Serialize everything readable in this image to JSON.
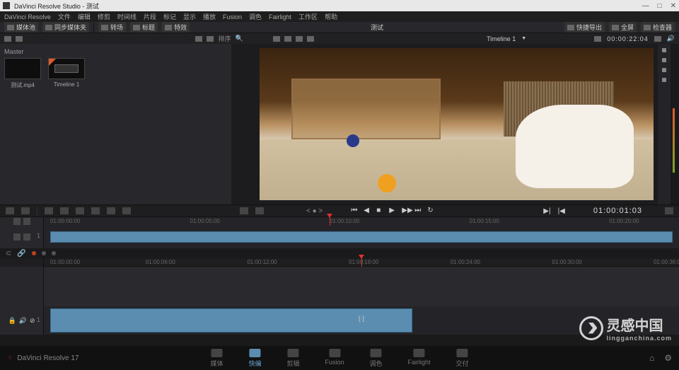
{
  "window": {
    "title": "DaVinci Resolve Studio - 测试",
    "min": "—",
    "max": "□",
    "close": "✕"
  },
  "menu": [
    "DaVinci Resolve",
    "文件",
    "编辑",
    "修剪",
    "时间线",
    "片段",
    "标记",
    "显示",
    "播放",
    "Fusion",
    "调色",
    "Fairlight",
    "工作区",
    "帮助"
  ],
  "toolbar": {
    "mediapool": "媒体池",
    "sync": "同步媒体夹",
    "transitions": "转场",
    "titles": "标题",
    "effects": "特效",
    "center": "测试",
    "quickexport": "快捷导出",
    "fullscreen": "全屏",
    "inspector": "检查器"
  },
  "subbar": {
    "timeline_name": "Timeline 1",
    "timecode": "00:00:22:04"
  },
  "pool": {
    "root": "Master",
    "clips": [
      {
        "name": "测试.mp4"
      },
      {
        "name": "Timeline 1"
      }
    ]
  },
  "transport": {
    "first": "⏮",
    "prev": "◀",
    "stop": "■",
    "play": "▶",
    "next": "▶▶",
    "last": "⏭",
    "loop": "↻",
    "skip_prev": "▶|",
    "skip_next": "|◀",
    "tc": "01:00:01:03"
  },
  "ruler_upper": [
    "01:00:00:00",
    "01:00:05:00",
    "01:00:10:00",
    "01:00:15:00",
    "01:00:20:00"
  ],
  "ruler_lower": [
    "01:00:00:00",
    "01:00:06:00",
    "01:00:12:00",
    "01:00:18:00",
    "01:00:24:00",
    "01:00:30:00",
    "01:00:36:00"
  ],
  "pages": [
    {
      "key": "media",
      "label": "媒体"
    },
    {
      "key": "cut",
      "label": "快编"
    },
    {
      "key": "edit",
      "label": "剪辑"
    },
    {
      "key": "fusion",
      "label": "Fusion"
    },
    {
      "key": "color",
      "label": "调色"
    },
    {
      "key": "fairlight",
      "label": "Fairlight"
    },
    {
      "key": "deliver",
      "label": "交付"
    }
  ],
  "footer": {
    "version": "DaVinci Resolve 17",
    "home": "⌂",
    "settings": "⚙"
  },
  "watermark": {
    "brand": "灵感中国",
    "domain": "lingganchina.com"
  },
  "track": {
    "v1": "1",
    "a1": "1",
    "lock": "🔒",
    "vol": "🔊",
    "dis": "⊘"
  }
}
